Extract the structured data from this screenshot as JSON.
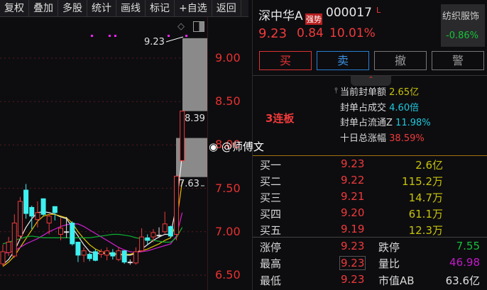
{
  "toolbar": [
    "复权",
    "叠加",
    "多股",
    "统计",
    "画线",
    "标记",
    "+自选",
    "返回"
  ],
  "stock": {
    "name": "深中华A",
    "tag": "强势",
    "code": "000017",
    "flag": "L",
    "price": "9.23",
    "change": "0.84",
    "pct": "10.01%",
    "sector": "纺织服饰",
    "sector_pct": "-0.86%"
  },
  "actions": {
    "buy": "买",
    "sell": "卖",
    "cancel": "撤",
    "alert": "警"
  },
  "board": "3连板",
  "seal": [
    {
      "label": "当前封单额",
      "value": "2.65亿",
      "color": "yel"
    },
    {
      "label": "封单占成交",
      "value": "4.60倍",
      "color": "cyan"
    },
    {
      "label": "封单占流通Z",
      "value": "11.98%",
      "color": "cyan"
    },
    {
      "label": "十日总涨幅",
      "value": "38.59%",
      "color": "red"
    }
  ],
  "watermark": "@师傅文",
  "orders": [
    {
      "label": "买一",
      "price": "9.23",
      "vol": "2.6亿"
    },
    {
      "label": "买二",
      "price": "9.22",
      "vol": "115.2万"
    },
    {
      "label": "买三",
      "price": "9.21",
      "vol": "14.7万"
    },
    {
      "label": "买四",
      "price": "9.20",
      "vol": "61.1万"
    },
    {
      "label": "买五",
      "price": "9.19",
      "vol": "12.3万"
    }
  ],
  "stats": {
    "limit_up_label": "涨停",
    "limit_up": "9.23",
    "limit_down_label": "跌停",
    "limit_down": "7.55",
    "high_label": "最高",
    "high": "9.23",
    "vol_ratio_label": "量比",
    "vol_ratio": "46.98",
    "low_label": "最低",
    "low": "9.23",
    "mcap_label": "市值AB",
    "mcap": "63.6亿"
  },
  "chart_data": {
    "type": "candlestick",
    "yticks": [
      "9.00",
      "8.50",
      "8.00",
      "7.50",
      "7.00",
      "6.50"
    ],
    "ylim": [
      6.4,
      9.3
    ],
    "annotations": {
      "high": "9.23",
      "gap1": "8.39",
      "gap2": "7.63"
    },
    "colors": {
      "up": "#f03a3a",
      "down": "#3ff0f0",
      "doji": "#e0e0e0"
    },
    "candles": [
      [
        6.63,
        6.77,
        6.85,
        6.6
      ],
      [
        6.76,
        6.88,
        6.94,
        6.72
      ],
      [
        6.72,
        7.1,
        7.2,
        6.7
      ],
      [
        6.95,
        7.35,
        7.4,
        6.9
      ],
      [
        7.48,
        7.21,
        7.55,
        7.15
      ],
      [
        7.28,
        7.18,
        7.3,
        7.03
      ],
      [
        7.14,
        7.22,
        7.35,
        7.05
      ],
      [
        7.38,
        7.2,
        7.38,
        7.18
      ],
      [
        7.1,
        7.18,
        7.2,
        6.97
      ],
      [
        7.29,
        7.22,
        7.29,
        7.13
      ],
      [
        6.97,
        7.04,
        7.16,
        6.9
      ],
      [
        7.0,
        7.0,
        7.17,
        6.93
      ],
      [
        7.1,
        6.86,
        7.12,
        6.84
      ],
      [
        6.88,
        6.73,
        6.88,
        6.65
      ],
      [
        6.73,
        6.78,
        6.82,
        6.65
      ],
      [
        6.74,
        6.69,
        6.76,
        6.66
      ],
      [
        6.77,
        6.67,
        6.8,
        6.66
      ],
      [
        6.74,
        6.77,
        6.8,
        6.7
      ],
      [
        6.73,
        6.78,
        6.82,
        6.67
      ],
      [
        6.76,
        6.72,
        6.8,
        6.68
      ],
      [
        6.68,
        6.78,
        6.82,
        6.66
      ],
      [
        6.78,
        6.65,
        6.78,
        6.63
      ],
      [
        6.65,
        6.65,
        6.68,
        6.62
      ],
      [
        6.64,
        6.77,
        6.82,
        6.62
      ],
      [
        6.78,
        6.94,
        7.04,
        6.77
      ],
      [
        6.93,
        6.9,
        6.97,
        6.85
      ],
      [
        6.94,
        6.99,
        7.03,
        6.88
      ],
      [
        6.96,
        6.96,
        7.05,
        6.93
      ],
      [
        7.0,
        7.09,
        7.23,
        6.98
      ],
      [
        7.06,
        6.95,
        7.07,
        6.93
      ],
      [
        6.97,
        7.64,
        7.64,
        6.9
      ],
      [
        7.82,
        8.39,
        8.39,
        7.8
      ]
    ],
    "ma": [
      {
        "color": "#f0f0f0",
        "values": [
          6.62,
          6.68,
          6.78,
          6.92,
          7.05,
          7.15,
          7.22,
          7.23,
          7.22,
          7.2,
          7.17,
          7.15,
          7.05,
          6.95,
          6.85,
          6.77,
          6.75,
          6.75,
          6.75,
          6.74,
          6.74,
          6.73,
          6.73,
          6.75,
          6.8,
          6.85,
          6.9,
          6.94,
          6.97,
          6.97,
          7.3,
          7.88
        ]
      },
      {
        "color": "#e0c000",
        "values": [
          6.6,
          6.65,
          6.72,
          6.82,
          6.92,
          7.02,
          7.12,
          7.18,
          7.2,
          7.2,
          7.18,
          7.16,
          7.1,
          7.0,
          6.92,
          6.85,
          6.8,
          6.77,
          6.76,
          6.75,
          6.74,
          6.74,
          6.74,
          6.76,
          6.78,
          6.8,
          6.83,
          6.86,
          6.9,
          6.93,
          7.1,
          7.58
        ]
      },
      {
        "color": "#d020d0",
        "values": [
          6.75,
          6.76,
          6.78,
          6.82,
          6.86,
          6.89,
          6.92,
          6.96,
          7.0,
          7.03,
          7.06,
          7.08,
          7.09,
          7.09,
          7.06,
          7.02,
          6.98,
          6.94,
          6.9,
          6.86,
          6.82,
          6.79,
          6.77,
          6.76,
          6.77,
          6.78,
          6.8,
          6.82,
          6.84,
          6.86,
          6.95,
          7.22
        ]
      },
      {
        "color": "#10b030",
        "values": [
          6.86,
          6.88,
          6.9,
          6.92,
          6.94,
          6.95,
          6.94,
          6.93,
          6.93,
          6.93,
          6.93,
          6.93,
          6.93,
          6.93,
          6.93,
          6.93,
          6.94,
          6.95,
          6.96,
          6.97,
          6.97,
          6.96,
          6.95,
          6.93,
          6.92,
          6.91,
          6.9,
          6.89,
          6.88,
          6.88,
          6.93,
          7.05
        ]
      }
    ]
  }
}
